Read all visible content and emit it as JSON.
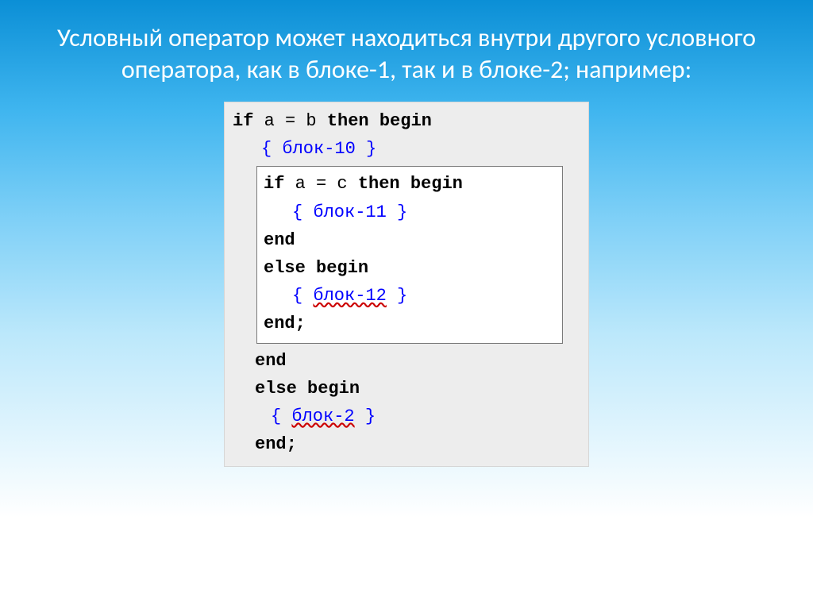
{
  "title": "Условный оператор может находиться внутри другого условного оператора, как в блоке-1, так и в блоке-2; например:",
  "code": {
    "l1": {
      "if": "if",
      "a": "a",
      "eq": "=",
      "b": "b",
      "then": "then",
      "begin": "begin"
    },
    "l2": {
      "open": "{ ",
      "txt": "блок-10",
      "close": " }"
    },
    "inner": {
      "l1": {
        "if": "if",
        "a": "a",
        "eq": "=",
        "c": "c",
        "then": "then",
        "begin": "begin"
      },
      "l2": {
        "open": "{ ",
        "txt": "блок-11",
        "close": " }"
      },
      "l3": {
        "end": "end"
      },
      "l4": {
        "else": "else",
        "begin": "begin"
      },
      "l5": {
        "open": "{ ",
        "txt": "блок-12",
        "close": " }"
      },
      "l6": {
        "end": "end;"
      }
    },
    "l3": {
      "end": "end"
    },
    "l4": {
      "else": "else",
      "begin": "begin"
    },
    "l5": {
      "open": "{ ",
      "txt": "блок-2",
      "close": " }"
    },
    "l6": {
      "end": "end;"
    }
  }
}
